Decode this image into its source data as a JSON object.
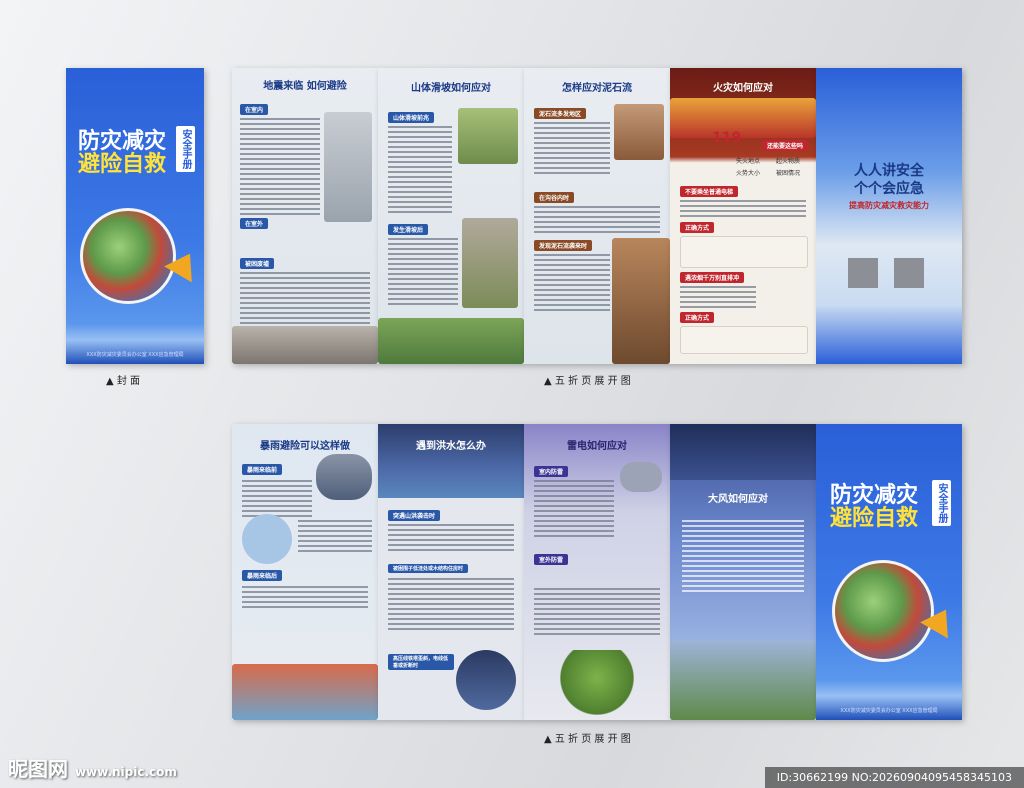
{
  "cover": {
    "title_line1": "防灾减灾",
    "title_line2": "避险自救",
    "tag": "安全手册",
    "footer": "XXX防灾减灾委员会办公室  XXX应急管理局"
  },
  "top_row": {
    "panel1_title": "地震来临 如何避险",
    "panel1_sections": [
      "在室内",
      "在室外",
      "被困废墟"
    ],
    "panel2_title": "山体滑坡如何应对",
    "panel2_sections": [
      "山体滑坡前兆",
      "发生滑坡后"
    ],
    "panel3_title": "怎样应对泥石流",
    "panel3_sections": [
      "泥石流多发地区",
      "在沟谷内时",
      "发现泥石流袭来时"
    ],
    "panel4_title": "火灾如何应对",
    "panel4_items": [
      "还能要这些吗",
      "失火地点",
      "起火物质",
      "火势大小",
      "被困情况"
    ],
    "panel4_sections": [
      "不要乘坐普通电梯",
      "正确方式",
      "遇浓烟千万别直排冲",
      "正确方式"
    ],
    "panel4_number": "119",
    "panel5_line1": "人人讲安全",
    "panel5_line2": "个个会应急",
    "panel5_line3": "提高防灾减灾救灾能力"
  },
  "bottom_row": {
    "panel1_title": "暴雨避险可以这样做",
    "panel1_sections": [
      "暴雨来临前",
      "暴雨来临后"
    ],
    "panel2_title": "遇到洪水怎么办",
    "panel2_sections": [
      "突遇山洪袭击时",
      "被困围子低洼处或木结构住房时",
      "高压线铁塔歪斜，电线低垂或折断时"
    ],
    "panel3_title": "雷电如何应对",
    "panel3_sections": [
      "室内防雷",
      "室外防雷"
    ],
    "panel4_title": "大风如何应对",
    "panel5_title_line1": "防灾减灾",
    "panel5_title_line2": "避险自救",
    "panel5_tag": "安全手册",
    "panel5_footer": "XXX防灾减灾委员会办公室  XXX应急管理局"
  },
  "captions": {
    "cover": "▲ 封 面",
    "top_spread": "▲ 五 折 页 展 开 图",
    "bottom_spread": "▲ 五 折 页 展 开 图"
  },
  "watermark": {
    "brand": "昵图网",
    "url": "www.nipic.com",
    "id_text": "ID:30662199 NO:20260904095458345103"
  },
  "colors": {
    "primary_blue": "#2a5fd8",
    "title_yellow": "#ffe23a",
    "fire_red": "#c0262d",
    "navy": "#1d3f8f"
  }
}
